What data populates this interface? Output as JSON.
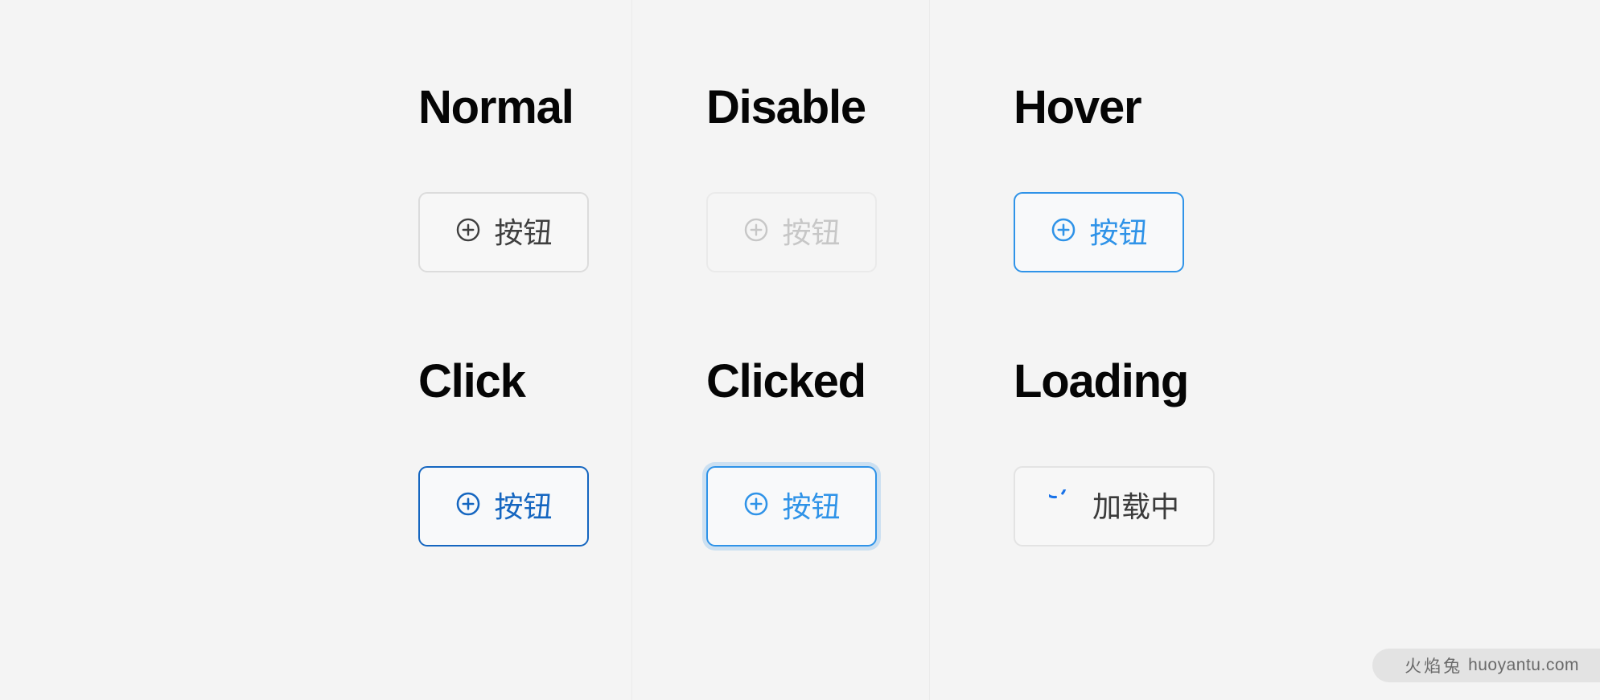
{
  "page": {
    "background_color": "#f4f4f4",
    "title_color": "#050505"
  },
  "palette": {
    "normal_border": "#dcdcdc",
    "normal_text": "#3f3f3f",
    "disable_border": "#eaeaea",
    "disable_text": "#c7c7c7",
    "hover_blue": "#2f93e8",
    "click_blue": "#1566c0",
    "clicked_blue": "#2f93e8",
    "loading_spinner": "#1a73e8",
    "loading_text": "#3b3b3b",
    "button_surface": "#f7f7f7"
  },
  "states": [
    {
      "key": "normal",
      "title": "Normal",
      "button_label": "按钮",
      "icon": "plus-circle-icon",
      "disabled": false
    },
    {
      "key": "disable",
      "title": "Disable",
      "button_label": "按钮",
      "icon": "plus-circle-icon",
      "disabled": true
    },
    {
      "key": "hover",
      "title": "Hover",
      "button_label": "按钮",
      "icon": "plus-circle-icon",
      "disabled": false
    },
    {
      "key": "click",
      "title": "Click",
      "button_label": "按钮",
      "icon": "plus-circle-icon",
      "disabled": false
    },
    {
      "key": "clicked",
      "title": "Clicked",
      "button_label": "按钮",
      "icon": "plus-circle-icon",
      "disabled": false
    },
    {
      "key": "loading",
      "title": "Loading",
      "button_label": "加载中",
      "icon": "spinner-icon",
      "disabled": false
    }
  ],
  "watermark": {
    "cn_text": "火焰兔",
    "site_text": "huoyantu.com"
  }
}
